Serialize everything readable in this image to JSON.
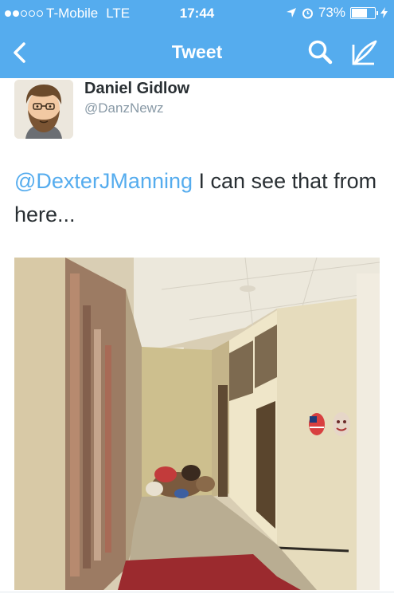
{
  "status": {
    "carrier": "T-Mobile",
    "network": "LTE",
    "time": "17:44",
    "battery": "73%",
    "battery_level": 0.73,
    "signal_bars_filled": 2,
    "signal_bars_total": 5
  },
  "nav": {
    "title": "Tweet",
    "back_icon": "chevron-left-icon",
    "search_icon": "search-icon",
    "compose_icon": "compose-icon"
  },
  "tweet": {
    "author_name": "Daniel Gidlow",
    "author_handle": "@DanzNewz",
    "mention": "@DexterJManning",
    "text": " I can see that from here..."
  },
  "colors": {
    "brand": "#55acee",
    "text": "#292f33",
    "secondary": "#8899a6"
  }
}
